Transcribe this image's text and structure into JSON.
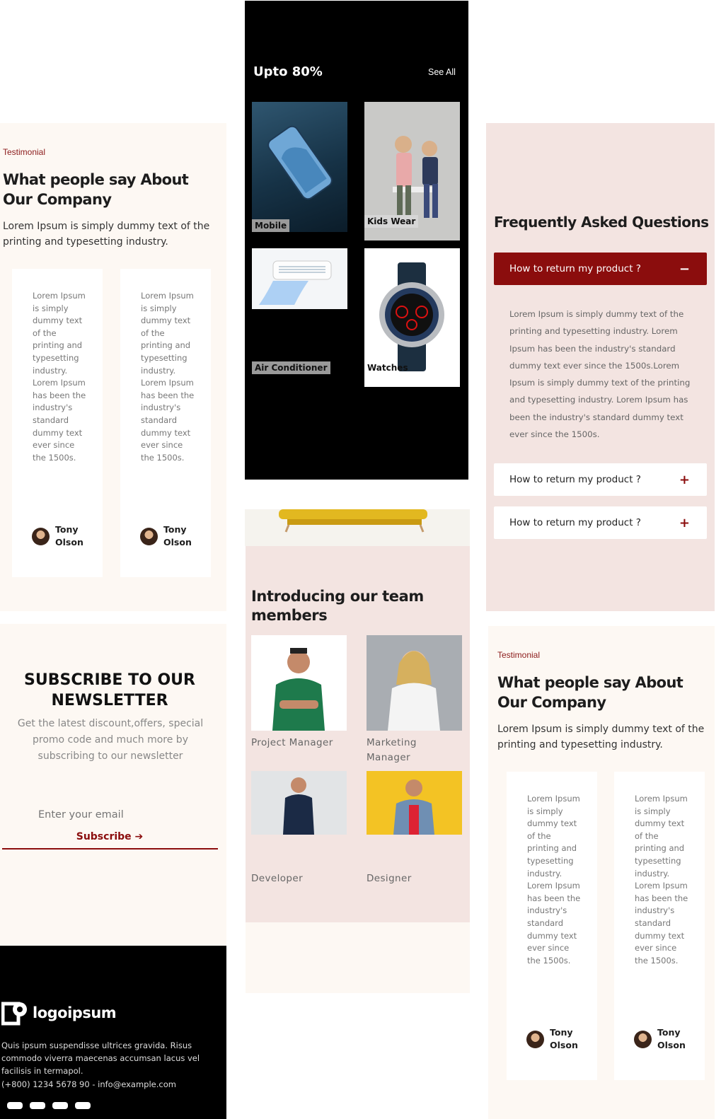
{
  "testimonial": {
    "eyebrow": "Testimonial",
    "title": "What people say About Our Company",
    "lead": "Lorem Ipsum is simply dummy text of the printing and typesetting industry.",
    "cards": [
      {
        "quote": "Lorem Ipsum is simply dummy text of the printing and typesetting industry. Lorem Ipsum has been the industry's standard dummy text ever since the 1500s.",
        "name": "Tony Olson"
      },
      {
        "quote": "Lorem Ipsum is simply dummy text of the printing and typesetting industry. Lorem Ipsum has been the industry's standard dummy text ever since the 1500s.",
        "name": "Tony Olson"
      }
    ]
  },
  "category": {
    "title": "Upto 80%",
    "see_all": "See All",
    "tiles": [
      {
        "label": "Mobile"
      },
      {
        "label": "Kids Wear"
      },
      {
        "label": "Air Conditioner"
      },
      {
        "label": "Watches"
      }
    ]
  },
  "faq": {
    "title": "Frequently Asked Questions",
    "items": [
      {
        "question": "How to return my product ?",
        "symbol": "−",
        "answer": "Lorem Ipsum is simply dummy text of the printing and typesetting industry. Lorem Ipsum has been the industry's standard dummy text ever since the 1500s.Lorem Ipsum is simply dummy text of the printing and typesetting industry. Lorem Ipsum has been the industry's standard dummy text ever since the 1500s."
      },
      {
        "question": "How to return my product ?",
        "symbol": "+"
      },
      {
        "question": "How to return my product ?",
        "symbol": "+"
      }
    ]
  },
  "team": {
    "title": "Introducing our team members",
    "members": [
      {
        "role": "Project Manager"
      },
      {
        "role": "Marketing Manager"
      },
      {
        "role": "Developer"
      },
      {
        "role": "Designer"
      }
    ]
  },
  "newsletter": {
    "title": "SUBSCRIBE TO OUR NEWSLETTER",
    "subtitle": "Get the latest discount,offers, special promo code and much more by subscribing to our newsletter",
    "email_placeholder": "Enter your email",
    "button": "Subscribe ➔"
  },
  "footer": {
    "logo": "logoipsum",
    "description": "Quis ipsum suspendisse ultrices gravida. Risus commodo viverra maecenas accumsan lacus vel facilisis in termapol.",
    "contact": "(+800) 1234 5678 90 - info@example.com"
  },
  "colors": {
    "accent": "#8b0d0d",
    "cream": "#fdf8f3",
    "blush": "#f3e4e1",
    "dark": "#000000"
  }
}
